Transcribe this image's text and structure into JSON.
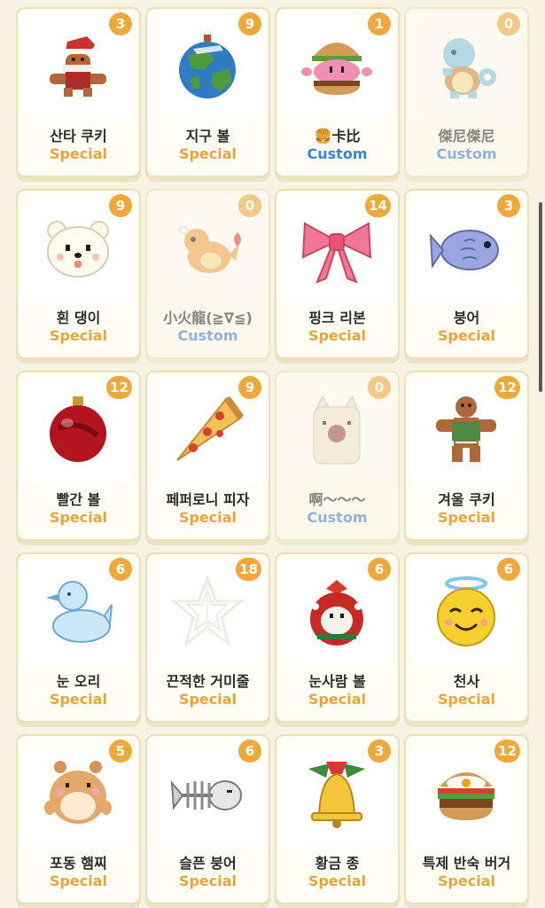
{
  "colors": {
    "background": "#f7f2e1",
    "special": "#e9a53b",
    "custom": "#3a83d6",
    "badge": "#efa83a"
  },
  "items": [
    {
      "name": "산타 쿠키",
      "type": "Special",
      "count": "3",
      "icon": "santa-gingerbread-icon",
      "locked": false
    },
    {
      "name": "지구 볼",
      "type": "Special",
      "count": "9",
      "icon": "earth-ornament-icon",
      "locked": false
    },
    {
      "name": "🍔卡比",
      "type": "Custom",
      "count": "1",
      "icon": "burger-kirby-icon",
      "locked": false
    },
    {
      "name": "傑尼傑尼",
      "type": "Custom",
      "count": "0",
      "icon": "squirtle-icon",
      "locked": true
    },
    {
      "name": "흰 댕이",
      "type": "Special",
      "count": "9",
      "icon": "white-puppy-icon",
      "locked": false
    },
    {
      "name": "小火龍(≧∇≦)",
      "type": "Custom",
      "count": "0",
      "icon": "charmander-icon",
      "locked": true
    },
    {
      "name": "핑크 리본",
      "type": "Special",
      "count": "14",
      "icon": "pink-ribbon-icon",
      "locked": false
    },
    {
      "name": "붕어",
      "type": "Special",
      "count": "3",
      "icon": "fish-bread-icon",
      "locked": false
    },
    {
      "name": "빨간 볼",
      "type": "Special",
      "count": "12",
      "icon": "red-ornament-icon",
      "locked": false
    },
    {
      "name": "페퍼로니 피자",
      "type": "Special",
      "count": "9",
      "icon": "pizza-slice-icon",
      "locked": false
    },
    {
      "name": "啊～～～",
      "type": "Custom",
      "count": "0",
      "icon": "screaming-cat-icon",
      "locked": true
    },
    {
      "name": "겨울 쿠키",
      "type": "Special",
      "count": "12",
      "icon": "winter-gingerbread-icon",
      "locked": false
    },
    {
      "name": "눈 오리",
      "type": "Special",
      "count": "6",
      "icon": "snow-duck-icon",
      "locked": false
    },
    {
      "name": "끈적한 거미줄",
      "type": "Special",
      "count": "18",
      "icon": "spider-web-icon",
      "locked": false
    },
    {
      "name": "눈사람 볼",
      "type": "Special",
      "count": "6",
      "icon": "snowman-ornament-icon",
      "locked": false
    },
    {
      "name": "천사",
      "type": "Special",
      "count": "6",
      "icon": "angel-emoji-icon",
      "locked": false
    },
    {
      "name": "포동 햄찌",
      "type": "Special",
      "count": "5",
      "icon": "hamster-icon",
      "locked": false
    },
    {
      "name": "슬픈 붕어",
      "type": "Special",
      "count": "6",
      "icon": "fish-skeleton-icon",
      "locked": false
    },
    {
      "name": "황금 종",
      "type": "Special",
      "count": "3",
      "icon": "golden-bell-icon",
      "locked": false
    },
    {
      "name": "특제 반숙 버거",
      "type": "Special",
      "count": "12",
      "icon": "egg-burger-icon",
      "locked": false
    }
  ]
}
